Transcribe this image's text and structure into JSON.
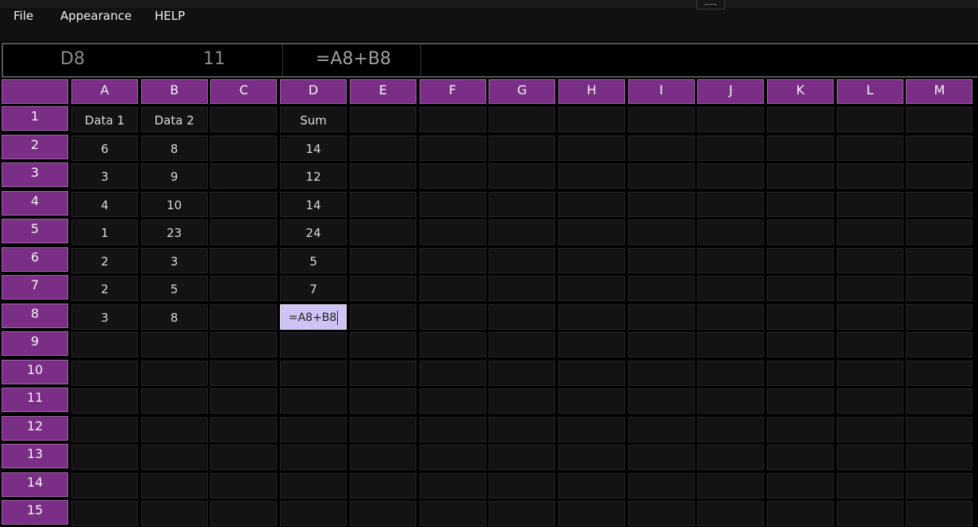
{
  "menu": {
    "items": [
      "File",
      "Appearance",
      "HELP"
    ]
  },
  "formula_bar": {
    "cell_ref": "D8",
    "cell_value": "11",
    "formula": "=A8+B8"
  },
  "grid": {
    "columns": [
      "A",
      "B",
      "C",
      "D",
      "E",
      "F",
      "G",
      "H",
      "I",
      "J",
      "K",
      "L",
      "M"
    ],
    "rows": [
      "1",
      "2",
      "3",
      "4",
      "5",
      "6",
      "7",
      "8",
      "9",
      "10",
      "11",
      "12",
      "13",
      "14",
      "15"
    ],
    "cells": [
      [
        "Data 1",
        "Data 2",
        "",
        "Sum",
        "",
        "",
        "",
        "",
        "",
        "",
        "",
        "",
        ""
      ],
      [
        "6",
        "8",
        "",
        "14",
        "",
        "",
        "",
        "",
        "",
        "",
        "",
        "",
        ""
      ],
      [
        "3",
        "9",
        "",
        "12",
        "",
        "",
        "",
        "",
        "",
        "",
        "",
        "",
        ""
      ],
      [
        "4",
        "10",
        "",
        "14",
        "",
        "",
        "",
        "",
        "",
        "",
        "",
        "",
        ""
      ],
      [
        "1",
        "23",
        "",
        "24",
        "",
        "",
        "",
        "",
        "",
        "",
        "",
        "",
        ""
      ],
      [
        "2",
        "3",
        "",
        "5",
        "",
        "",
        "",
        "",
        "",
        "",
        "",
        "",
        ""
      ],
      [
        "2",
        "5",
        "",
        "7",
        "",
        "",
        "",
        "",
        "",
        "",
        "",
        "",
        ""
      ],
      [
        "3",
        "8",
        "",
        "=A8+B8",
        "",
        "",
        "",
        "",
        "",
        "",
        "",
        "",
        ""
      ],
      [
        "",
        "",
        "",
        "",
        "",
        "",
        "",
        "",
        "",
        "",
        "",
        "",
        ""
      ],
      [
        "",
        "",
        "",
        "",
        "",
        "",
        "",
        "",
        "",
        "",
        "",
        "",
        ""
      ],
      [
        "",
        "",
        "",
        "",
        "",
        "",
        "",
        "",
        "",
        "",
        "",
        "",
        ""
      ],
      [
        "",
        "",
        "",
        "",
        "",
        "",
        "",
        "",
        "",
        "",
        "",
        "",
        ""
      ],
      [
        "",
        "",
        "",
        "",
        "",
        "",
        "",
        "",
        "",
        "",
        "",
        "",
        ""
      ],
      [
        "",
        "",
        "",
        "",
        "",
        "",
        "",
        "",
        "",
        "",
        "",
        "",
        ""
      ],
      [
        "",
        "",
        "",
        "",
        "",
        "",
        "",
        "",
        "",
        "",
        "",
        "",
        ""
      ]
    ],
    "active_cell": {
      "row": 8,
      "column": "D"
    }
  },
  "colors": {
    "header_purple": "#7a2e86",
    "cell_bg": "#141214",
    "editing_cell_bg": "#cec3f4",
    "window_bg": "#000000"
  }
}
